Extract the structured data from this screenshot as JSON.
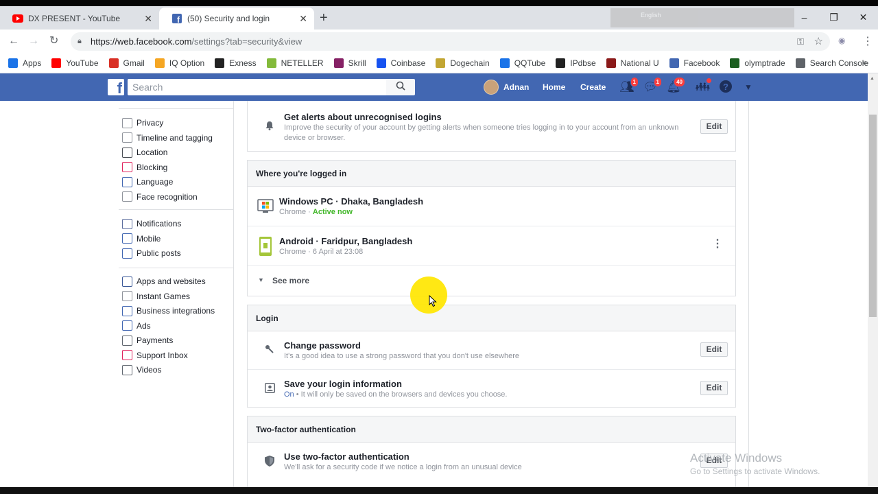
{
  "browser": {
    "tabs": [
      {
        "title": "DX PRESENT - YouTube",
        "active": false,
        "icon": "youtube-icon"
      },
      {
        "title": "(50) Security and login",
        "active": true,
        "icon": "facebook-icon"
      }
    ],
    "new_tab": "+",
    "url_host": "https://web.facebook.com",
    "url_path": "/settings?tab=security&view",
    "ime_label": "English",
    "window_controls": {
      "minimize": "–",
      "maximize": "❐",
      "close": "✕"
    }
  },
  "bookmarks": [
    {
      "label": "Apps",
      "icon": "apps-grid-icon",
      "color": "#1a73e8"
    },
    {
      "label": "YouTube",
      "icon": "youtube-icon",
      "color": "#ff0000"
    },
    {
      "label": "Gmail",
      "icon": "gmail-icon",
      "color": "#d93025"
    },
    {
      "label": "IQ Option",
      "icon": "iqoption-icon",
      "color": "#f5a623"
    },
    {
      "label": "Exness",
      "icon": "exness-icon",
      "color": "#222222"
    },
    {
      "label": "NETELLER",
      "icon": "neteller-icon",
      "color": "#83ba3b"
    },
    {
      "label": "Skrill",
      "icon": "skrill-icon",
      "color": "#862165"
    },
    {
      "label": "Coinbase",
      "icon": "coinbase-icon",
      "color": "#1652f0"
    },
    {
      "label": "Dogechain",
      "icon": "dogechain-icon",
      "color": "#c2a633"
    },
    {
      "label": "QQTube",
      "icon": "search-icon",
      "color": "#1a73e8"
    },
    {
      "label": "IPdbse",
      "icon": "ipdbse-icon",
      "color": "#222222"
    },
    {
      "label": "National U",
      "icon": "nu-icon",
      "color": "#8b1a1a"
    },
    {
      "label": "Facebook",
      "icon": "facebook-icon",
      "color": "#4267b2"
    },
    {
      "label": "olymptrade",
      "icon": "olymptrade-icon",
      "color": "#1b5e20"
    },
    {
      "label": "Search Console",
      "icon": "search-console-icon",
      "color": "#5f6368"
    }
  ],
  "bookmarks_more": "»",
  "fb": {
    "search_placeholder": "Search",
    "user_name": "Adnan",
    "nav_home": "Home",
    "nav_create": "Create",
    "badges": {
      "friends": "1",
      "messages": "1",
      "notifications": "40"
    },
    "brand_color": "#4267b2"
  },
  "sidebar": {
    "groups": [
      [
        {
          "label": "Privacy",
          "icon": "privacy-lock-icon"
        },
        {
          "label": "Timeline and tagging",
          "icon": "timeline-icon"
        },
        {
          "label": "Location",
          "icon": "location-icon"
        },
        {
          "label": "Blocking",
          "icon": "blocking-icon"
        },
        {
          "label": "Language",
          "icon": "language-icon"
        },
        {
          "label": "Face recognition",
          "icon": "face-recognition-icon"
        }
      ],
      [
        {
          "label": "Notifications",
          "icon": "notifications-globe-icon"
        },
        {
          "label": "Mobile",
          "icon": "mobile-icon"
        },
        {
          "label": "Public posts",
          "icon": "public-posts-icon"
        }
      ],
      [
        {
          "label": "Apps and websites",
          "icon": "apps-websites-icon"
        },
        {
          "label": "Instant Games",
          "icon": "instant-games-icon"
        },
        {
          "label": "Business integrations",
          "icon": "business-integrations-icon"
        },
        {
          "label": "Ads",
          "icon": "ads-icon"
        },
        {
          "label": "Payments",
          "icon": "payments-icon"
        },
        {
          "label": "Support Inbox",
          "icon": "support-inbox-icon"
        },
        {
          "label": "Videos",
          "icon": "videos-icon"
        }
      ]
    ]
  },
  "alerts": {
    "title": "Get alerts about unrecognised logins",
    "sub1": "Improve the security of your account by getting alerts when someone tries logging in to your account from an unknown",
    "sub2": "device or browser.",
    "edit": "Edit"
  },
  "logged_in": {
    "heading": "Where you're logged in",
    "devices": [
      {
        "title": "Windows PC · Dhaka, Bangladesh",
        "browser": "Chrome · ",
        "status": "Active now"
      },
      {
        "title": "Android · Faridpur, Bangladesh",
        "browser": "Chrome · ",
        "status": "6 April at 23:08"
      }
    ],
    "see_more": "See more"
  },
  "login": {
    "heading": "Login",
    "items": [
      {
        "title": "Change password",
        "sub": "It's a good idea to use a strong password that you don't use elsewhere",
        "edit": "Edit"
      },
      {
        "title": "Save your login information",
        "sub_on": "On",
        "sub": " • It will only be saved on the browsers and devices you choose.",
        "edit": "Edit"
      }
    ]
  },
  "twofactor": {
    "heading": "Two-factor authentication",
    "title": "Use two-factor authentication",
    "sub": "We'll ask for a security code if we notice a login from an unusual device",
    "edit": "Edit"
  },
  "watermark": {
    "line1": "Activate Windows",
    "line2": "Go to Settings to activate Windows."
  }
}
